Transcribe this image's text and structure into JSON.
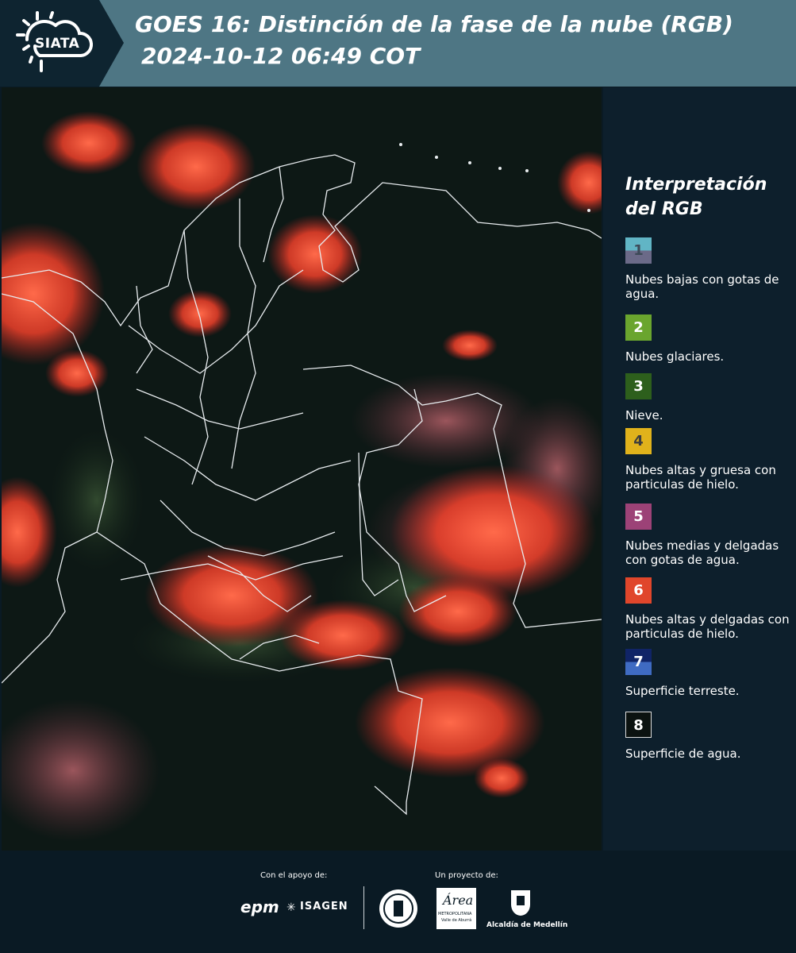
{
  "header": {
    "logo_text": "SIATA",
    "title_line1": "GOES 16: Distinción de la fase de la nube (RGB)",
    "title_line2": "2024-10-12 06:49 COT"
  },
  "legend": {
    "title": "Interpretación del RGB",
    "items": [
      {
        "number": "1",
        "label": "Nubes bajas con gotas de agua.",
        "color": "#61b5c5",
        "color2": "#6b6a88"
      },
      {
        "number": "2",
        "label": "Nubes glaciares.",
        "color": "#6aa52e"
      },
      {
        "number": "3",
        "label": "Nieve.",
        "color": "#2d5f1c"
      },
      {
        "number": "4",
        "label": "Nubes altas y gruesa con particulas de hielo.",
        "color": "#e0b21b"
      },
      {
        "number": "5",
        "label": "Nubes medias y delgadas con gotas de agua.",
        "color": "#9c4277"
      },
      {
        "number": "6",
        "label": "Nubes altas y delgadas con particulas de hielo.",
        "color": "#e0462b"
      },
      {
        "number": "7",
        "label": "Superficie terreste.",
        "color": "#102467",
        "color2": "#3f6bc2"
      },
      {
        "number": "8",
        "label": "Superficie de agua.",
        "color": "#0b1210"
      }
    ]
  },
  "footer": {
    "support_label": "Con el apoyo de:",
    "project_label": "Un proyecto de:",
    "sponsor1": "epm",
    "sponsor2": "ISAGEN",
    "partner_area": "Área",
    "partner_area_sub1": "METROPOLITANA",
    "partner_area_sub2": "Valle de Aburrá",
    "partner_alcaldia": "Alcaldía de Medellín"
  }
}
